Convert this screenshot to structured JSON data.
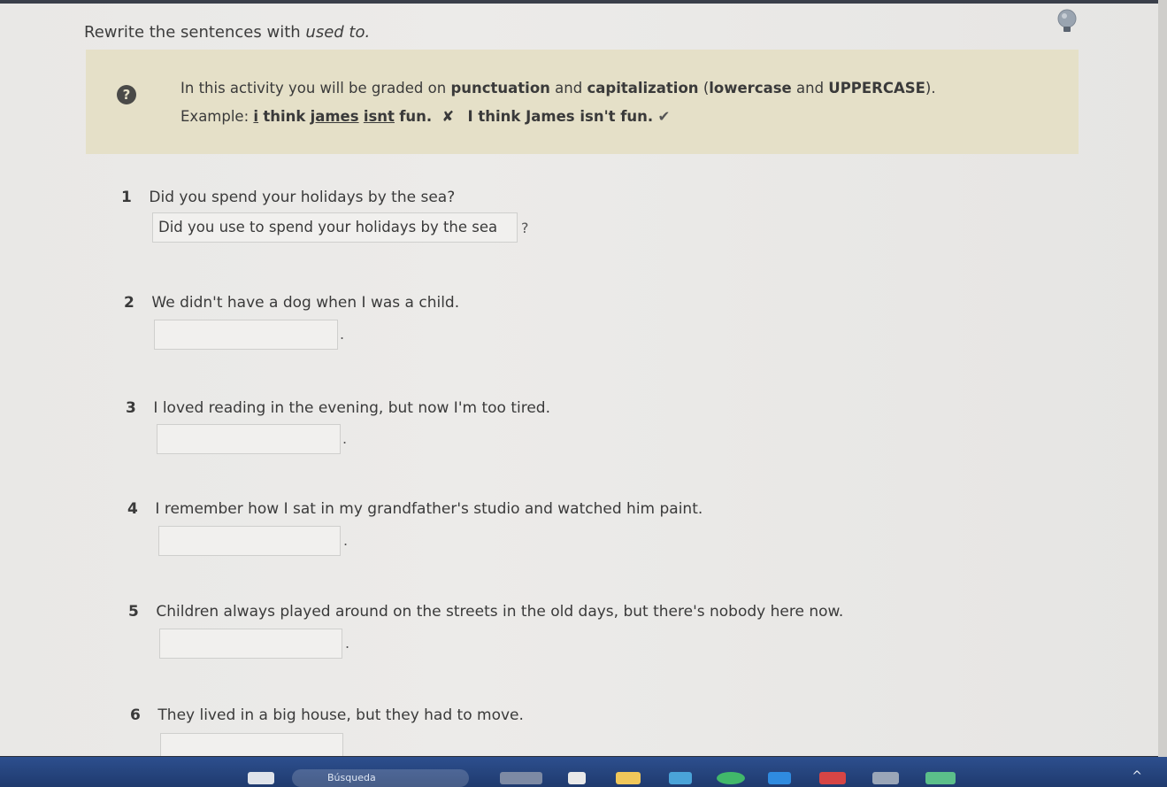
{
  "instruction": {
    "prefix": "Rewrite the sentences with",
    "emph": "used to."
  },
  "notice": {
    "icon": "question-circle-icon",
    "line1_a": "In this activity you will be graded on",
    "line1_b": "punctuation",
    "line1_c": "and",
    "line1_d": "capitalization",
    "line1_e": "(",
    "line1_f": "lowercase",
    "line1_g": "and",
    "line1_h": "UPPERCASE",
    "line1_i": ").",
    "example_label": "Example:",
    "wrong_1": "i",
    "wrong_2": "think",
    "wrong_3": "james",
    "wrong_4": "isnt",
    "wrong_5": "fun.",
    "wrong_mark": "✘",
    "correct": "I think James isn't fun.",
    "correct_mark": "✔"
  },
  "questions": [
    {
      "num": "1",
      "text": "Did you spend your holidays by the sea?",
      "answer": "Did you use to spend your holidays by the sea",
      "ending": "?"
    },
    {
      "num": "2",
      "text": "We didn't have a dog when I was a child.",
      "answer": "",
      "ending": "."
    },
    {
      "num": "3",
      "text": "I loved reading in the evening, but now I'm too tired.",
      "answer": "",
      "ending": "."
    },
    {
      "num": "4",
      "text": "I remember how I sat in my grandfather's studio and watched him paint.",
      "answer": "",
      "ending": "."
    },
    {
      "num": "5",
      "text": "Children always played around on the streets in the old days, but there's nobody here now.",
      "answer": "",
      "ending": "."
    },
    {
      "num": "6",
      "text": "They lived in a big house, but they had to move.",
      "answer": "",
      "ending": ""
    }
  ],
  "taskbar": {
    "search_placeholder": "Búsqueda"
  },
  "colors": {
    "notice_bg": "#e5e0c8",
    "page_bg": "#ebeae8",
    "taskbar": "#1f3a6e"
  }
}
